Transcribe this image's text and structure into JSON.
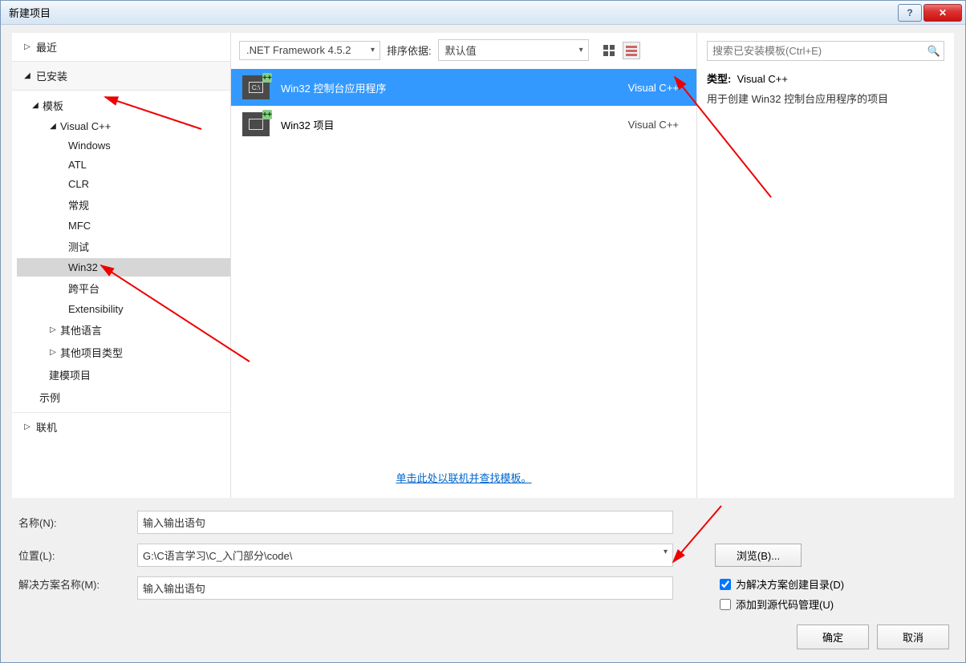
{
  "window": {
    "title": "新建项目"
  },
  "sidebar": {
    "recent": "最近",
    "installed": "已安装",
    "tree": {
      "templates": "模板",
      "vcpp": "Visual C++",
      "children": [
        "Windows",
        "ATL",
        "CLR",
        "常规",
        "MFC",
        "测试",
        "Win32",
        "跨平台",
        "Extensibility"
      ],
      "other_lang": "其他语言",
      "other_proj": "其他项目类型",
      "modeling": "建模项目",
      "samples": "示例"
    },
    "online": "联机"
  },
  "toolbar": {
    "framework": ".NET Framework 4.5.2",
    "sort_label": "排序依据:",
    "sort_value": "默认值"
  },
  "templates": [
    {
      "name": "Win32 控制台应用程序",
      "lang": "Visual C++",
      "selected": true,
      "icon": "console"
    },
    {
      "name": "Win32 项目",
      "lang": "Visual C++",
      "selected": false,
      "icon": "project"
    }
  ],
  "center_link": "单击此处以联机并查找模板。",
  "search": {
    "placeholder": "搜索已安装模板(Ctrl+E)"
  },
  "description": {
    "type_label": "类型:",
    "type_value": "Visual C++",
    "body": "用于创建 Win32 控制台应用程序的项目"
  },
  "form": {
    "name_label": "名称(N):",
    "name_value": "输入输出语句",
    "loc_label": "位置(L):",
    "loc_value": "G:\\C语言学习\\C_入门部分\\code\\",
    "sol_label": "解决方案名称(M):",
    "sol_value": "输入输出语句",
    "browse": "浏览(B)...",
    "chk_create_dir": "为解决方案创建目录(D)",
    "chk_source_control": "添加到源代码管理(U)"
  },
  "buttons": {
    "ok": "确定",
    "cancel": "取消"
  }
}
